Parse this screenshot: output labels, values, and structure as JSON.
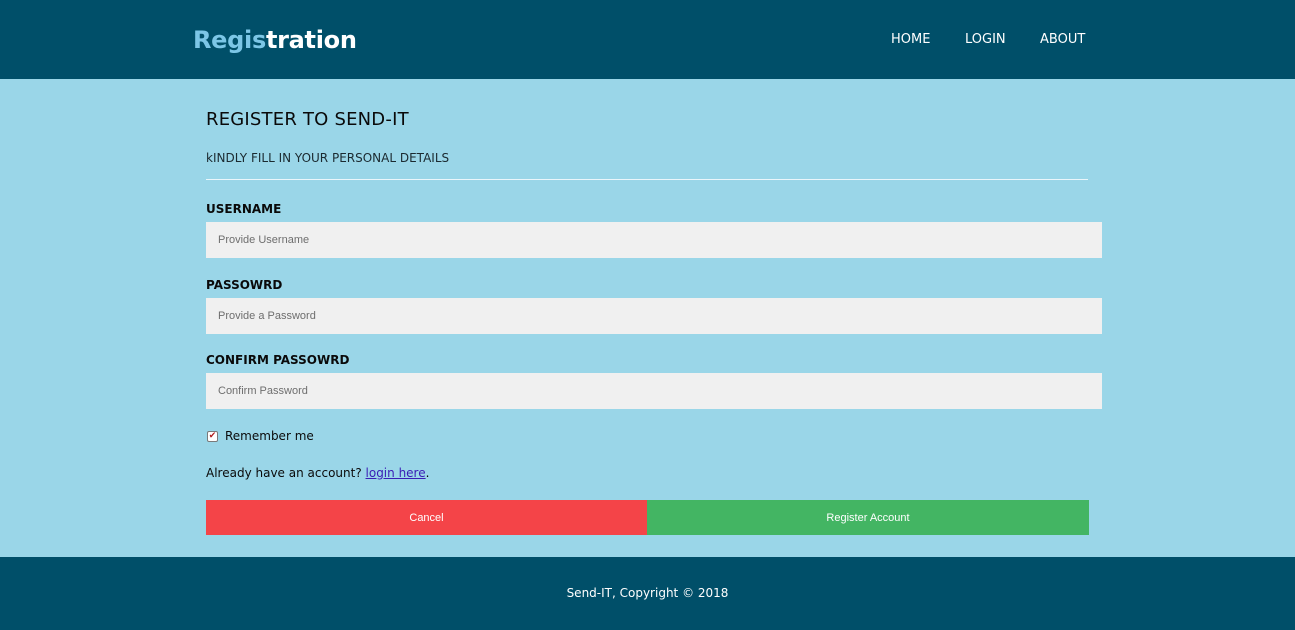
{
  "header": {
    "brand_part1": "Regis",
    "brand_part2": "tration",
    "nav": {
      "home": "HOME",
      "login": "LOGIN",
      "about": "ABOUT"
    }
  },
  "form": {
    "title": "REGISTER TO SEND-IT",
    "subtitle": "kINDLY FILL IN YOUR PERSONAL DETAILS",
    "username": {
      "label": "USERNAME",
      "placeholder": "Provide Username",
      "value": ""
    },
    "password": {
      "label": "PASSOWRD",
      "placeholder": "Provide a Password",
      "value": ""
    },
    "confirm_password": {
      "label": "CONFIRM PASSOWRD",
      "placeholder": "Confirm Password",
      "value": ""
    },
    "remember": {
      "label": "Remember me",
      "checked": true,
      "check_glyph": "✔"
    },
    "account_prompt": "Already have an account? ",
    "account_link": "login here",
    "account_suffix": ".",
    "cancel_label": "Cancel",
    "register_label": "Register Account"
  },
  "footer": {
    "text": "Send-IT, Copyright © 2018"
  },
  "colors": {
    "header_bg": "#004f69",
    "page_bg": "#9ad6e8",
    "input_bg": "#f0f0f0",
    "cancel": "#f44448",
    "register": "#43b563",
    "brand_accent": "#7cc6e6",
    "link": "#3a1db5"
  }
}
